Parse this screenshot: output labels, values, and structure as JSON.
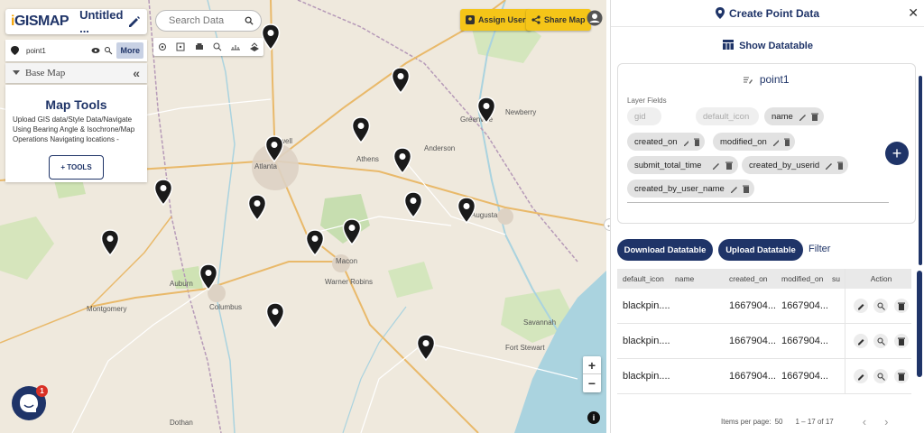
{
  "app": {
    "logo": "GISMAP",
    "logo_i": "i",
    "project_title": "Untitled ..."
  },
  "search": {
    "placeholder": "Search Data"
  },
  "layer": {
    "name": "point1",
    "more_label": "More"
  },
  "basemap": {
    "label": "Base Map"
  },
  "tools": {
    "title": "Map Tools",
    "description": "Upload GIS data/Style Data/Navigate Using Bearing Angle & Isochrone/Map Operations Navigating locations -",
    "button_label": "+ TOOLS"
  },
  "header_buttons": {
    "assign_user": "Assign User",
    "share_map": "Share Map"
  },
  "zoom": {
    "in": "+",
    "out": "−"
  },
  "chat": {
    "badge": "1"
  },
  "map": {
    "cities": [
      "Montgomery",
      "Columbus",
      "Auburn",
      "Macon",
      "Warner Robins",
      "Greenville",
      "Anderson",
      "Newberry",
      "Athens",
      "Roswell",
      "Atlanta",
      "Augusta",
      "Savannah",
      "Fort Stewart",
      "Dothan"
    ]
  },
  "panel": {
    "title": "Create Point Data",
    "show_datatable": "Show Datatable",
    "layer_title": "point1",
    "layer_fields_label": "Layer Fields",
    "fields": [
      {
        "name": "gid",
        "disabled": true
      },
      {
        "name": "default_icon",
        "disabled": true
      },
      {
        "name": "name",
        "disabled": false
      },
      {
        "name": "created_on",
        "disabled": false
      },
      {
        "name": "modified_on",
        "disabled": false
      },
      {
        "name": "submit_total_time",
        "disabled": false
      },
      {
        "name": "created_by_userid",
        "disabled": false
      },
      {
        "name": "created_by_user_name",
        "disabled": false
      }
    ],
    "add_label": "+",
    "download_label": "Download Datatable",
    "upload_label": "Upload Datatable",
    "filter_label": "Filter"
  },
  "table": {
    "headers": [
      "default_icon",
      "name",
      "created_on",
      "modified_on",
      "su",
      "Action"
    ],
    "rows": [
      {
        "default_icon": "blackpin....",
        "created_on": "1667904...",
        "modified_on": "1667904..."
      },
      {
        "default_icon": "blackpin....",
        "created_on": "1667904...",
        "modified_on": "1667904..."
      },
      {
        "default_icon": "blackpin....",
        "created_on": "1667904...",
        "modified_on": "1667904..."
      }
    ]
  },
  "pager": {
    "items_per_page_label": "Items per page:",
    "items_per_page": "50",
    "range": "1 – 17 of 17"
  },
  "colors": {
    "primary": "#1f3468",
    "accent": "#f5c518",
    "map_bg": "#efe9dd"
  }
}
